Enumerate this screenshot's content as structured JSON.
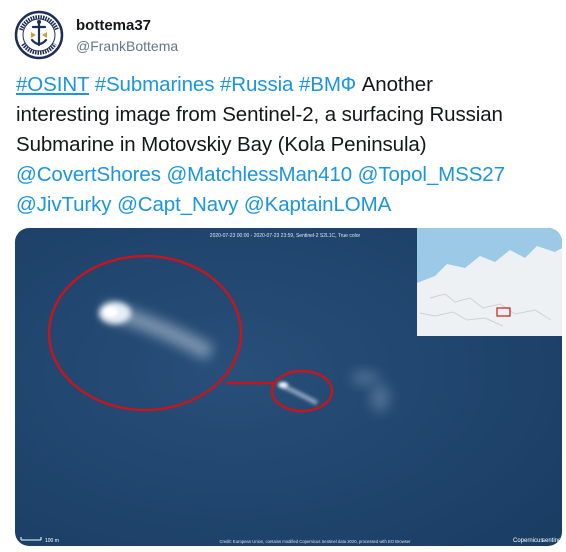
{
  "user": {
    "display_name": "bottema37",
    "handle": "@FrankBottema",
    "avatar_icon": "naval-crest-icon"
  },
  "tweet": {
    "line1": {
      "hashtags": [
        "#OSINT",
        "#Submarines",
        "#Russia",
        "#ВМФ"
      ],
      "text": "Another"
    },
    "line2": "interesting image from Sentinel-2, a surfacing Russian",
    "line3": "Submarine in Motovskiy Bay (Kola Peninsula)",
    "mentions_line4": [
      "@CovertShores",
      "@MatchlessMan410",
      "@Topol_MSS27"
    ],
    "mentions_line5": [
      "@JivTurky",
      "@Capt_Navy",
      "@KaptainLOMA"
    ]
  },
  "media": {
    "top_caption": "2020-07-23 00:00 - 2020-07-23 23:59, Sentinel-2 S2L1C, True color",
    "scale": "100 m",
    "credit": "Credit: European Union, contains modified Copernicus Sentinel data 2020, processed with EO Browser",
    "logo_left": "Copernicus",
    "logo_right": "sentinel",
    "colors": {
      "sea": "#1f4670",
      "circle": "#c4161c",
      "inset_land": "#eef1f4",
      "inset_sea": "#9cc9e6"
    }
  },
  "colors": {
    "link": "#1b95e0",
    "text": "#14171a",
    "muted": "#657786"
  }
}
